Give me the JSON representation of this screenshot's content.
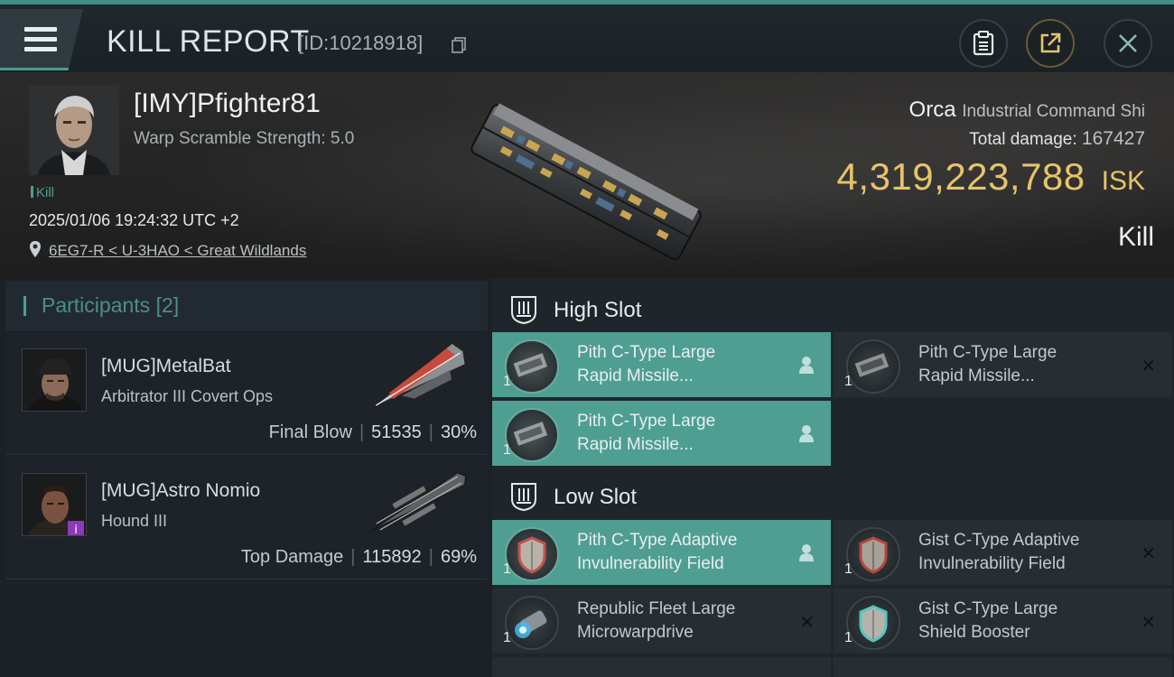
{
  "header": {
    "title": "KILL REPORT",
    "report_id": "[ID:10218918]"
  },
  "victim": {
    "name": "[IMY]Pfighter81",
    "warp_scramble": "Warp Scramble Strength: 5.0",
    "tag": "Kill",
    "datetime": "2025/01/06 19:24:32 UTC +2",
    "location": "6EG7-R < U-3HAO < Great Wildlands"
  },
  "ship": {
    "name": "Orca",
    "class": "Industrial Command Shi",
    "total_damage_label": "Total damage:",
    "total_damage_value": "167427",
    "isk_value": "4,319,223,788",
    "isk_unit": "ISK",
    "result": "Kill"
  },
  "participants": {
    "label": "Participants",
    "count": "[2]",
    "items": [
      {
        "name": "[MUG]MetalBat",
        "ship": "Arbitrator III Covert Ops",
        "role": "Final Blow",
        "damage": "51535",
        "percent": "30%"
      },
      {
        "name": "[MUG]Astro Nomio",
        "ship": "Hound III",
        "role": "Top Damage",
        "damage": "115892",
        "percent": "69%"
      }
    ]
  },
  "slots": {
    "high": {
      "label": "High Slot",
      "modules": [
        {
          "name_line1": "Pith C-Type Large",
          "name_line2": "Rapid Missile...",
          "qty": "1",
          "state": "fitted"
        },
        {
          "name_line1": "Pith C-Type Large",
          "name_line2": "Rapid Missile...",
          "qty": "1",
          "state": "destroyed"
        },
        {
          "name_line1": "Pith C-Type Large",
          "name_line2": "Rapid Missile...",
          "qty": "1",
          "state": "fitted"
        }
      ]
    },
    "low": {
      "label": "Low Slot",
      "modules": [
        {
          "name_line1": "Pith C-Type Adaptive",
          "name_line2": "Invulnerability Field",
          "qty": "1",
          "state": "fitted"
        },
        {
          "name_line1": "Gist C-Type Adaptive",
          "name_line2": "Invulnerability Field",
          "qty": "1",
          "state": "destroyed"
        },
        {
          "name_line1": "Republic Fleet Large",
          "name_line2": "Microwarpdrive",
          "qty": "1",
          "state": "destroyed"
        },
        {
          "name_line1": "Gist C-Type Large",
          "name_line2": "Shield Booster",
          "qty": "1",
          "state": "destroyed"
        }
      ]
    }
  },
  "colors": {
    "accent": "#4f9e92",
    "isk": "#e8c36a",
    "panel": "#1f262b"
  }
}
